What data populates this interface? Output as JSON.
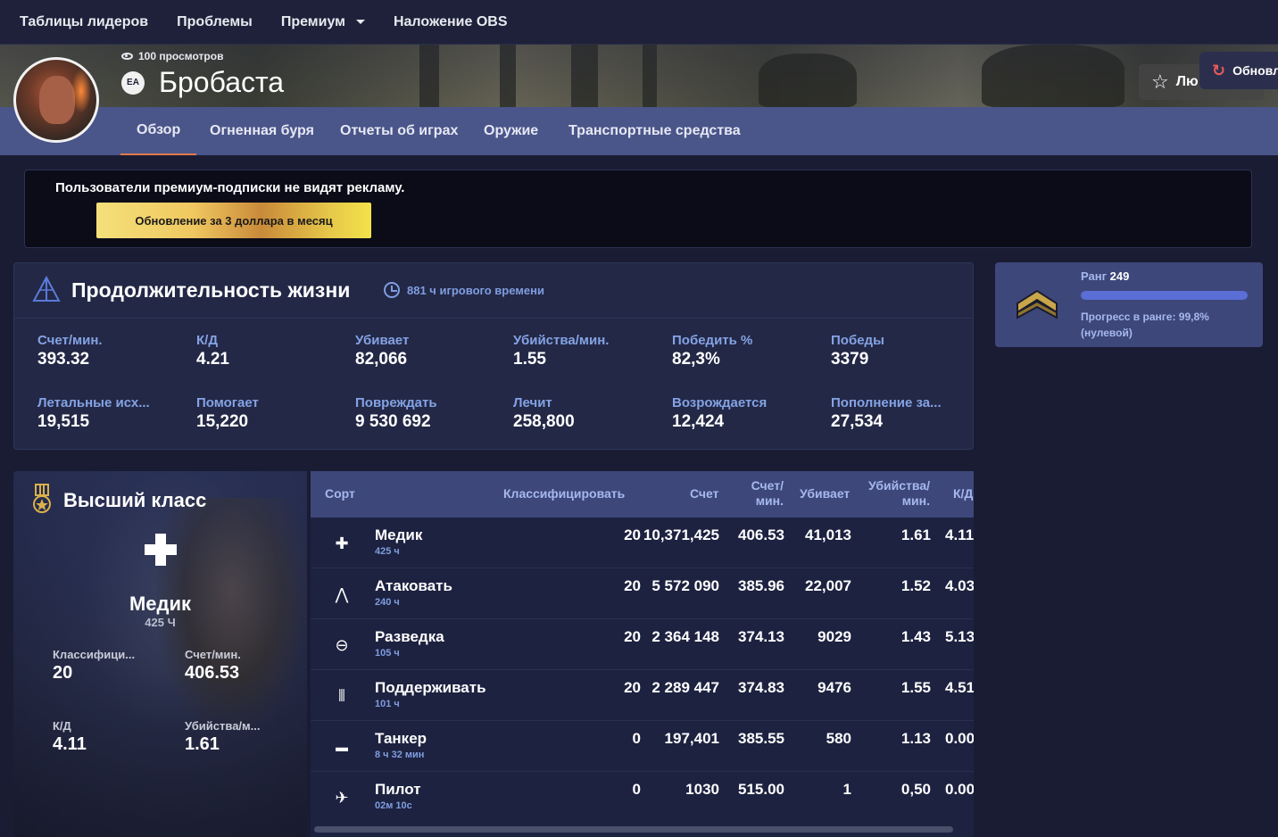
{
  "topnav": {
    "items": [
      "Таблицы лидеров",
      "Проблемы",
      "Премиум",
      "Наложение OBS"
    ]
  },
  "profile": {
    "views": "100 просмотров",
    "platform_badge": "EA",
    "name": "Бробаста",
    "favorite_label": "Лю",
    "update_label": "Обновл",
    "tabs": [
      "Обзор",
      "Огненная буря",
      "Отчеты об играх",
      "Оружие",
      "Транспортные средства"
    ],
    "active_tab": "Обзор"
  },
  "premium": {
    "message": "Пользователи премиум-подписки не видят рекламу.",
    "button": "Обновление за 3 доллара в месяц"
  },
  "lifetime": {
    "title": "Продолжительность жизни",
    "playtime": "881 ч игрового времени",
    "stats": [
      {
        "label": "Счет/мин.",
        "value": "393.32"
      },
      {
        "label": "К/Д",
        "value": "4.21"
      },
      {
        "label": "Убивает",
        "value": "82,066"
      },
      {
        "label": "Убийства/мин.",
        "value": "1.55"
      },
      {
        "label": "Победить %",
        "value": "82,3%"
      },
      {
        "label": "Победы",
        "value": "3379"
      },
      {
        "label": "Летальные исх...",
        "value": "19,515"
      },
      {
        "label": "Помогает",
        "value": "15,220"
      },
      {
        "label": "Повреждать",
        "value": "9 530 692"
      },
      {
        "label": "Лечит",
        "value": "258,800"
      },
      {
        "label": "Возрождается",
        "value": "12,424"
      },
      {
        "label": "Пополнение за...",
        "value": "27,534"
      }
    ]
  },
  "rank": {
    "label": "Ранг",
    "value": "249",
    "progress_fraction": 0.998,
    "progress_text": "Прогресс в ранге: 99,8% (нулевой)"
  },
  "top_class": {
    "title": "Высший класс",
    "class_name": "Медик",
    "hours": "425 Ч",
    "stats": [
      {
        "label": "Классифици...",
        "value": "20"
      },
      {
        "label": "Счет/мин.",
        "value": "406.53"
      },
      {
        "label": "К/Д",
        "value": "4.11"
      },
      {
        "label": "Убийства/м...",
        "value": "1.61"
      }
    ]
  },
  "class_table": {
    "headers": {
      "sort": "Сорт",
      "rank": "Классифицировать",
      "score": "Счет",
      "spm_1": "Счет/",
      "spm_2": "мин.",
      "kills": "Убивает",
      "kpm_1": "Убийства/",
      "kpm_2": "мин.",
      "kd": "К/Д"
    },
    "rows": [
      {
        "icon": "medic-icon",
        "name": "Медик",
        "time": "425 ч",
        "rank": "20",
        "score": "10,371,425",
        "spm": "406.53",
        "kills": "41,013",
        "kpm": "1.61",
        "kd": "4.11"
      },
      {
        "icon": "assault-icon",
        "name": "Атаковать",
        "time": "240 ч",
        "rank": "20",
        "score": "5 572 090",
        "spm": "385.96",
        "kills": "22,007",
        "kpm": "1.52",
        "kd": "4.03"
      },
      {
        "icon": "recon-icon",
        "name": "Разведка",
        "time": "105 ч",
        "rank": "20",
        "score": "2 364 148",
        "spm": "374.13",
        "kills": "9029",
        "kpm": "1.43",
        "kd": "5.13"
      },
      {
        "icon": "support-icon",
        "name": "Поддерживать",
        "time": "101 ч",
        "rank": "20",
        "score": "2 289 447",
        "spm": "374.83",
        "kills": "9476",
        "kpm": "1.55",
        "kd": "4.51"
      },
      {
        "icon": "tank-icon",
        "name": "Танкер",
        "time": "8 ч 32 мин",
        "rank": "0",
        "score": "197,401",
        "spm": "385.55",
        "kills": "580",
        "kpm": "1.13",
        "kd": "0.00"
      },
      {
        "icon": "plane-icon",
        "name": "Пилот",
        "time": "02м 10с",
        "rank": "0",
        "score": "1030",
        "spm": "515.00",
        "kills": "1",
        "kpm": "0,50",
        "kd": "0.00"
      }
    ]
  },
  "colors": {
    "background": "#191c33",
    "nav": "#1e2139",
    "tabs_bar": "#4a558a",
    "card": "#232846",
    "accent_label": "#84a3e4",
    "active_tab_underline": "#e07a4a",
    "premium_gold": "#f0c860"
  }
}
